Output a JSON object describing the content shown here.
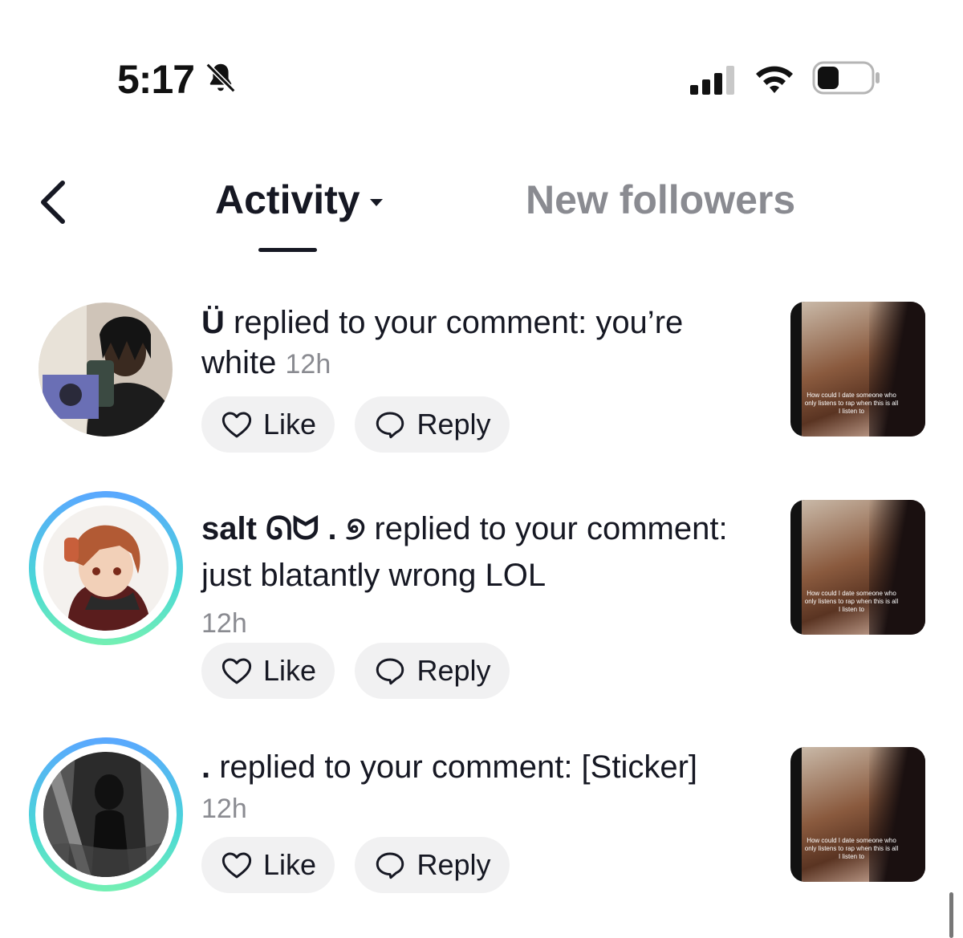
{
  "status_bar": {
    "time": "5:17",
    "icons": [
      "bell-slash-icon",
      "cellular-signal-icon",
      "wifi-icon",
      "battery-icon"
    ]
  },
  "header": {
    "back_icon": "chevron-left-icon",
    "tabs": [
      {
        "label": "Activity",
        "active": true,
        "has_dropdown": true
      },
      {
        "label": "New followers",
        "active": false
      }
    ]
  },
  "notifications": [
    {
      "username": "Ü",
      "text": " replied to your comment: you’re white",
      "time": "12h",
      "has_story_ring": false,
      "like_label": "Like",
      "reply_label": "Reply",
      "thumbnail_caption": "How could I date someone who only listens to rap when this is all I listen to"
    },
    {
      "username": "salt ᘏᗢ . ୭",
      "text": " replied to your comment: just blatantly wrong LOL",
      "time": "12h",
      "has_story_ring": true,
      "like_label": "Like",
      "reply_label": "Reply",
      "thumbnail_caption": "How could I date someone who only listens to rap when this is all I listen to"
    },
    {
      "username": ".",
      "text": " replied to your comment: [Sticker]",
      "time": "12h",
      "has_story_ring": true,
      "like_label": "Like",
      "reply_label": "Reply",
      "thumbnail_caption": "How could I date someone who only listens to rap when this is all I listen to"
    }
  ],
  "colors": {
    "primary_text": "#161823",
    "secondary_text": "#8a8b91",
    "button_bg": "#f1f1f2",
    "ring_gradient_start": "#5aa7ff",
    "ring_gradient_end": "#74f0b3"
  }
}
